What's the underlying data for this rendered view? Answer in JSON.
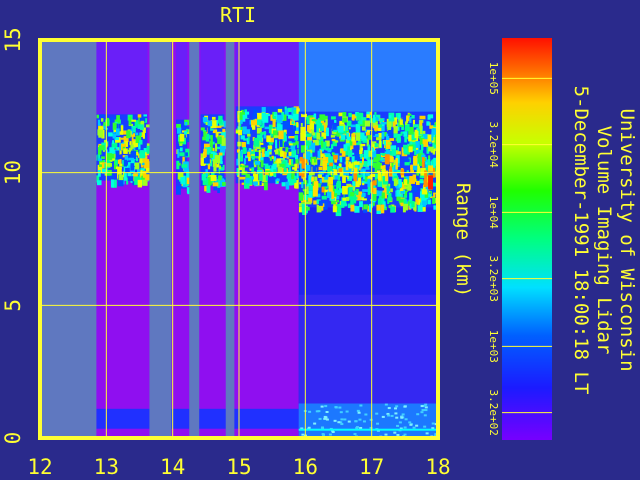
{
  "chart_data": {
    "type": "heatmap",
    "title": "RTI",
    "xlabel": "",
    "ylabel": "Range (km)",
    "xlim": [
      12,
      18
    ],
    "ylim": [
      0,
      15
    ],
    "x_ticks": [
      "12",
      "13",
      "14",
      "15",
      "16",
      "17",
      "18"
    ],
    "y_ticks": [
      "0",
      "5",
      "10",
      "15"
    ],
    "grid": true,
    "colorbar": {
      "scale": "log",
      "range": [
        200,
        200000
      ],
      "tick_labels": [
        "3.2e+02",
        "1e+03",
        "3.2e+03",
        "1e+04",
        "3.2e+04",
        "1e+05"
      ]
    },
    "side_text": [
      "University of Wisconsin",
      "Volume Imaging Lidar",
      "5-December-1991 18:00:18 LT"
    ],
    "data_gaps_hours": [
      [
        12.0,
        12.85
      ],
      [
        13.65,
        13.98
      ],
      [
        14.25,
        14.4
      ],
      [
        14.8,
        14.93
      ]
    ],
    "cloud_layer": {
      "segments": [
        {
          "x_start": 12.85,
          "x_end": 13.62,
          "base_km": 9.7,
          "top_km": 12.2
        },
        {
          "x_start": 14.05,
          "x_end": 14.22,
          "base_km": 9.4,
          "top_km": 12.0
        },
        {
          "x_start": 14.42,
          "x_end": 14.78,
          "base_km": 9.5,
          "top_km": 12.2
        },
        {
          "x_start": 14.95,
          "x_end": 15.9,
          "base_km": 9.6,
          "top_km": 12.5
        },
        {
          "x_start": 15.9,
          "x_end": 18.0,
          "base_km": 8.7,
          "top_km": 12.3
        }
      ]
    },
    "boundary_layer": [
      {
        "x_start": 12.85,
        "x_end": 15.9,
        "top_km": 1.1
      },
      {
        "x_start": 15.9,
        "x_end": 18.0,
        "top_km": 1.3
      }
    ]
  }
}
